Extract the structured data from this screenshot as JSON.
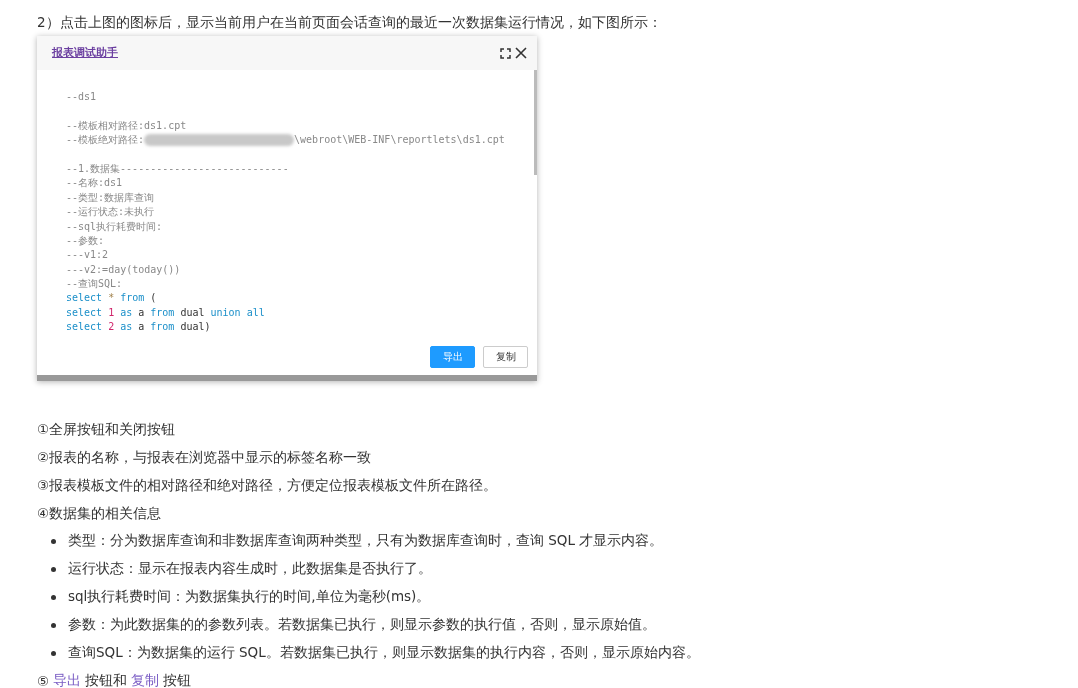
{
  "intro": "2）点击上图的图标后，显示当前用户在当前页面会话查询的最近一次数据集运行情况，如下图所示：",
  "dialog": {
    "title": "报表调试助手",
    "code_lines": [
      {
        "tokens": [
          {
            "kind": "comment",
            "text": "--ds1"
          }
        ]
      },
      {
        "gap_before": true,
        "tokens": [
          {
            "kind": "comment",
            "text": "--模板相对路径:ds1.cpt"
          }
        ]
      },
      {
        "tokens": [
          {
            "kind": "comment",
            "text": "--模板绝对路径:"
          },
          {
            "kind": "redacted"
          },
          {
            "kind": "comment",
            "text": "\\webroot\\WEB-INF\\reportlets\\ds1.cpt"
          }
        ]
      },
      {
        "gap_before": true,
        "tokens": [
          {
            "kind": "comment",
            "text": "--1.数据集----------------------------"
          }
        ]
      },
      {
        "tokens": [
          {
            "kind": "comment",
            "text": "--名称:ds1"
          }
        ]
      },
      {
        "tokens": [
          {
            "kind": "comment",
            "text": "--类型:数据库查询"
          }
        ]
      },
      {
        "tokens": [
          {
            "kind": "comment",
            "text": "--运行状态:未执行"
          }
        ]
      },
      {
        "tokens": [
          {
            "kind": "comment",
            "text": "--sql执行耗费时间:"
          }
        ]
      },
      {
        "tokens": [
          {
            "kind": "comment",
            "text": "--参数:"
          }
        ]
      },
      {
        "tokens": [
          {
            "kind": "comment",
            "text": "---v1:2"
          }
        ]
      },
      {
        "tokens": [
          {
            "kind": "comment",
            "text": "---v2:=day(today())"
          }
        ]
      },
      {
        "tokens": [
          {
            "kind": "comment",
            "text": "--查询SQL:"
          }
        ]
      },
      {
        "tokens": [
          {
            "kind": "keyword",
            "text": "select"
          },
          {
            "kind": "operator",
            "text": " * "
          },
          {
            "kind": "keyword",
            "text": "from"
          },
          {
            "kind": "plain",
            "text": " ("
          }
        ]
      },
      {
        "tokens": [
          {
            "kind": "keyword",
            "text": "select"
          },
          {
            "kind": "number",
            "text": " 1 "
          },
          {
            "kind": "keyword",
            "text": "as"
          },
          {
            "kind": "plain",
            "text": " a "
          },
          {
            "kind": "keyword",
            "text": "from"
          },
          {
            "kind": "plain",
            "text": " dual "
          },
          {
            "kind": "keyword",
            "text": "union all"
          }
        ]
      },
      {
        "tokens": [
          {
            "kind": "keyword",
            "text": "select"
          },
          {
            "kind": "number",
            "text": " 2 "
          },
          {
            "kind": "keyword",
            "text": "as"
          },
          {
            "kind": "plain",
            "text": " a "
          },
          {
            "kind": "keyword",
            "text": "from"
          },
          {
            "kind": "plain",
            "text": " dual)"
          }
        ]
      }
    ],
    "buttons": [
      {
        "label": "导出",
        "kind": "primary"
      },
      {
        "label": "复制",
        "kind": "default"
      }
    ]
  },
  "notes": [
    "①全屏按钮和关闭按钮",
    "②报表的名称，与报表在浏览器中显示的标签名称一致",
    "③报表模板文件的相对路径和绝对路径，方便定位报表模板文件所在路径。",
    "④数据集的相关信息"
  ],
  "bullets": [
    "类型：分为数据库查询和非数据库查询两种类型，只有为数据库查询时，查询 SQL 才显示内容。",
    "运行状态：显示在报表内容生成时，此数据集是否执行了。",
    "sql执行耗费时间：为数据集执行的时间,单位为毫秒(ms)。",
    "参数：为此数据集的的参数列表。若数据集已执行，则显示参数的执行值，否则，显示原始值。",
    "查询SQL：为数据集的运行 SQL。若数据集已执行，则显示数据集的执行内容，否则，显示原始内容。"
  ],
  "last_note": [
    {
      "kind": "text",
      "text": "⑤"
    },
    {
      "kind": "link",
      "text": "导出"
    },
    {
      "kind": "text",
      "text": "按钮和"
    },
    {
      "kind": "link",
      "text": "复制"
    },
    {
      "kind": "text",
      "text": "按钮"
    }
  ]
}
